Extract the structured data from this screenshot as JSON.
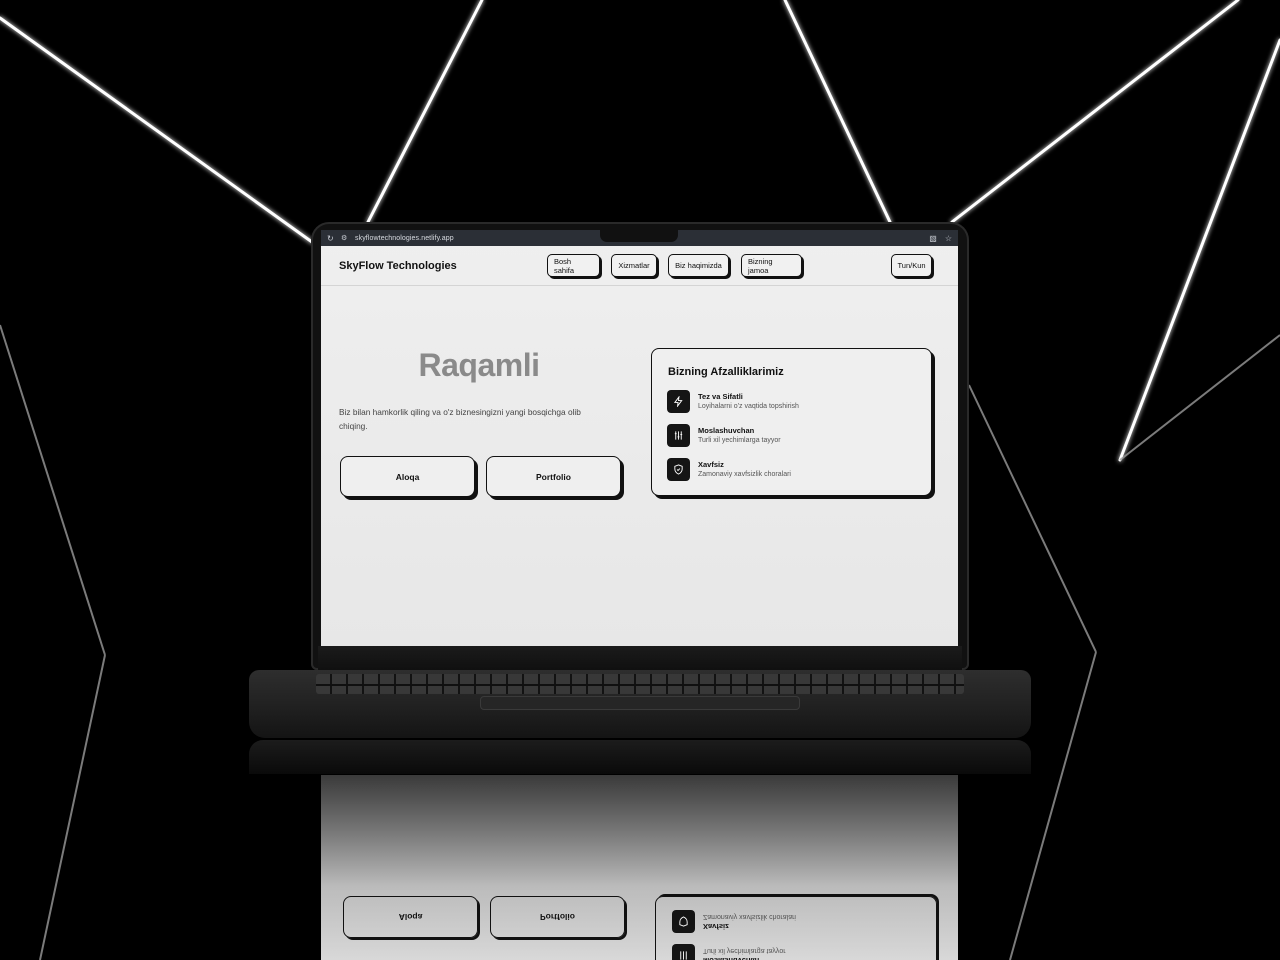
{
  "browser": {
    "url": "skyflowtechnologies.netlify.app",
    "reload_icon": "reload-icon",
    "site_settings_icon": "site-settings-icon",
    "translate_icon": "translate-icon",
    "bookmark_icon": "star-icon"
  },
  "header": {
    "brand": "SkyFlow Technologies",
    "nav": [
      "Bosh sahifa",
      "Xizmatlar",
      "Biz haqimizda",
      "Bizning jamoa"
    ],
    "theme_toggle": "Tun/Kun"
  },
  "hero": {
    "title": "Raqamli",
    "text": "Biz bilan hamkorlik qiling va o'z biznesingizni yangi bosqichga olib chiqing.",
    "buttons": [
      "Aloqa",
      "Portfolio"
    ]
  },
  "advantages": {
    "title": "Bizning Afzalliklarimiz",
    "items": [
      {
        "title": "Tez va Sifatli",
        "desc": "Loyihalarni o'z vaqtida topshirish",
        "icon": "bolt-icon"
      },
      {
        "title": "Moslashuvchan",
        "desc": "Turli xil yechimlarga tayyor",
        "icon": "sliders-icon"
      },
      {
        "title": "Xavfsiz",
        "desc": "Zamonaviy xavfsizlik choralari",
        "icon": "shield-icon"
      }
    ]
  },
  "colors": {
    "background": "#000000",
    "screen": "#efefef",
    "accent": "#111111",
    "hero_title": "#8a8a8a"
  }
}
